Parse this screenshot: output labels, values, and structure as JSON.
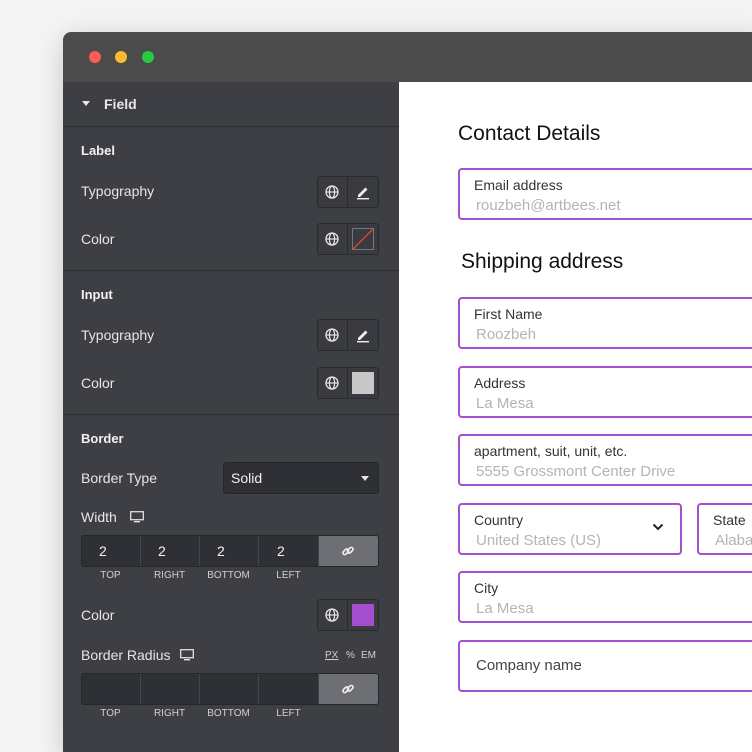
{
  "panel": {
    "title": "Field",
    "label_section": "Label",
    "typography": "Typography",
    "color": "Color",
    "input_section": "Input",
    "border_section": "Border",
    "border_type_label": "Border Type",
    "border_type_value": "Solid",
    "width_label": "Width",
    "width_values": [
      "2",
      "2",
      "2",
      "2"
    ],
    "dim_labels": [
      "TOP",
      "RIGHT",
      "BOTTOM",
      "LEFT"
    ],
    "border_color_label": "Color",
    "border_color": "#a34fd0",
    "input_color": "#c8c8c8",
    "border_radius_label": "Border Radius",
    "units": [
      "PX",
      "%",
      "EM"
    ],
    "radius_values": [
      "",
      "",
      "",
      ""
    ]
  },
  "form": {
    "contact_heading": "Contact Details",
    "email_label": "Email address",
    "email_value": "rouzbeh@artbees.net",
    "shipping_heading": "Shipping address",
    "first_name_label": "First Name",
    "first_name_value": "Roozbeh",
    "address_label": "Address",
    "address_value": "La Mesa",
    "apt_label": "apartment, suit, unit, etc.",
    "apt_value": "5555 Grossmont Center Drive",
    "country_label": "Country",
    "country_value": "United States (US)",
    "state_label": "State",
    "state_value": "Alaba",
    "city_label": "City",
    "city_value": "La Mesa",
    "company_placeholder": "Company name"
  }
}
